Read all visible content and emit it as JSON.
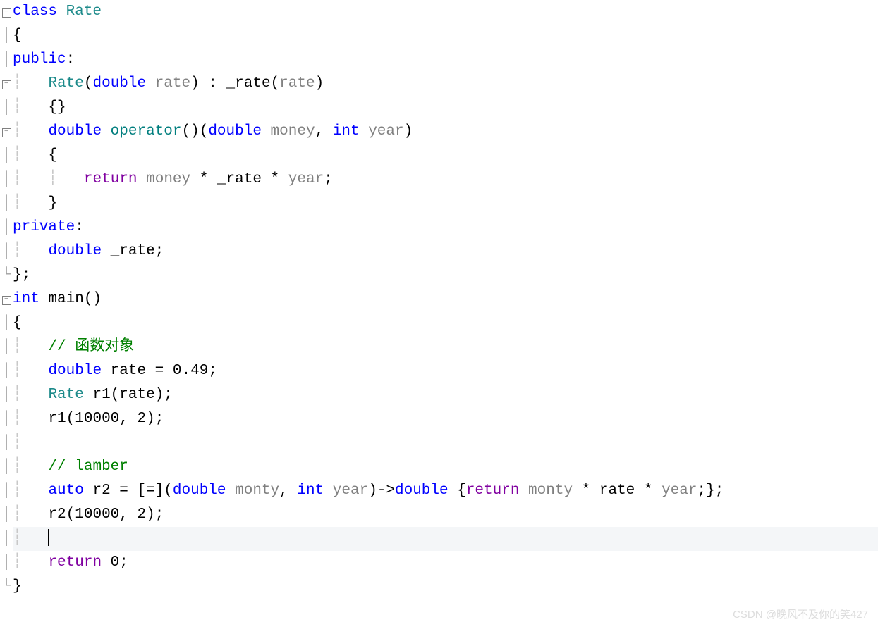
{
  "code": {
    "lines": [
      {
        "gutter": "fold",
        "tokens": [
          {
            "t": "class ",
            "c": "kw-class"
          },
          {
            "t": "Rate",
            "c": "typename"
          }
        ]
      },
      {
        "gutter": "vline",
        "tokens": [
          {
            "t": "{",
            "c": "brace"
          }
        ]
      },
      {
        "gutter": "vline",
        "tokens": [
          {
            "t": "public",
            "c": "kw-access"
          },
          {
            "t": ":",
            "c": "punct"
          }
        ]
      },
      {
        "gutter": "fold",
        "indent": 1,
        "tokens": [
          {
            "t": "Rate",
            "c": "typename"
          },
          {
            "t": "(",
            "c": "punct"
          },
          {
            "t": "double ",
            "c": "kw-type"
          },
          {
            "t": "rate",
            "c": "param"
          },
          {
            "t": ") : _rate(",
            "c": "punct"
          },
          {
            "t": "rate",
            "c": "param"
          },
          {
            "t": ")",
            "c": "punct"
          }
        ]
      },
      {
        "gutter": "vline",
        "indent": 1,
        "tokens": [
          {
            "t": "{}",
            "c": "brace"
          }
        ]
      },
      {
        "gutter": "fold",
        "indent": 1,
        "tokens": [
          {
            "t": "double ",
            "c": "kw-type"
          },
          {
            "t": "operator",
            "c": "kw-op"
          },
          {
            "t": "()(",
            "c": "punct"
          },
          {
            "t": "double ",
            "c": "kw-type"
          },
          {
            "t": "money",
            "c": "param"
          },
          {
            "t": ", ",
            "c": "punct"
          },
          {
            "t": "int ",
            "c": "kw-type"
          },
          {
            "t": "year",
            "c": "param"
          },
          {
            "t": ")",
            "c": "punct"
          }
        ]
      },
      {
        "gutter": "vline",
        "indent": 1,
        "tokens": [
          {
            "t": "{",
            "c": "brace"
          }
        ]
      },
      {
        "gutter": "vline",
        "indent": 2,
        "tokens": [
          {
            "t": "return ",
            "c": "kw-return"
          },
          {
            "t": "money",
            "c": "param"
          },
          {
            "t": " * _rate * ",
            "c": "punct"
          },
          {
            "t": "year",
            "c": "param"
          },
          {
            "t": ";",
            "c": "punct"
          }
        ]
      },
      {
        "gutter": "vline",
        "indent": 1,
        "tokens": [
          {
            "t": "}",
            "c": "brace"
          }
        ]
      },
      {
        "gutter": "vline",
        "tokens": [
          {
            "t": "private",
            "c": "kw-access"
          },
          {
            "t": ":",
            "c": "punct"
          }
        ]
      },
      {
        "gutter": "vline",
        "indent": 1,
        "tokens": [
          {
            "t": "double ",
            "c": "kw-type"
          },
          {
            "t": "_rate;",
            "c": "punct"
          }
        ]
      },
      {
        "gutter": "corner",
        "tokens": [
          {
            "t": "};",
            "c": "brace"
          }
        ]
      },
      {
        "gutter": "fold",
        "tokens": [
          {
            "t": "int ",
            "c": "kw-type"
          },
          {
            "t": "main()",
            "c": "punct"
          }
        ]
      },
      {
        "gutter": "vline",
        "tokens": [
          {
            "t": "{",
            "c": "brace"
          }
        ]
      },
      {
        "gutter": "vline",
        "indent": 1,
        "tokens": [
          {
            "t": "// 函数对象",
            "c": "comment"
          }
        ]
      },
      {
        "gutter": "vline",
        "indent": 1,
        "tokens": [
          {
            "t": "double ",
            "c": "kw-type"
          },
          {
            "t": "rate = ",
            "c": "punct"
          },
          {
            "t": "0.49",
            "c": "num"
          },
          {
            "t": ";",
            "c": "punct"
          }
        ]
      },
      {
        "gutter": "vline",
        "indent": 1,
        "tokens": [
          {
            "t": "Rate ",
            "c": "typename"
          },
          {
            "t": "r1(rate);",
            "c": "punct"
          }
        ]
      },
      {
        "gutter": "vline",
        "indent": 1,
        "tokens": [
          {
            "t": "r1(",
            "c": "punct"
          },
          {
            "t": "10000",
            "c": "num"
          },
          {
            "t": ", ",
            "c": "punct"
          },
          {
            "t": "2",
            "c": "num"
          },
          {
            "t": ");",
            "c": "punct"
          }
        ]
      },
      {
        "gutter": "vline",
        "indent": 1,
        "tokens": []
      },
      {
        "gutter": "vline",
        "indent": 1,
        "tokens": [
          {
            "t": "// lamber",
            "c": "comment"
          }
        ]
      },
      {
        "gutter": "vline",
        "indent": 1,
        "tokens": [
          {
            "t": "auto ",
            "c": "kw-auto"
          },
          {
            "t": "r2 = [=](",
            "c": "punct"
          },
          {
            "t": "double ",
            "c": "kw-type"
          },
          {
            "t": "monty",
            "c": "param"
          },
          {
            "t": ", ",
            "c": "punct"
          },
          {
            "t": "int ",
            "c": "kw-type"
          },
          {
            "t": "year",
            "c": "param"
          },
          {
            "t": ")->",
            "c": "punct"
          },
          {
            "t": "double ",
            "c": "kw-type"
          },
          {
            "t": "{",
            "c": "brace"
          },
          {
            "t": "return ",
            "c": "kw-return"
          },
          {
            "t": "monty",
            "c": "param"
          },
          {
            "t": " * rate * ",
            "c": "punct"
          },
          {
            "t": "year",
            "c": "param"
          },
          {
            "t": ";};",
            "c": "brace"
          }
        ]
      },
      {
        "gutter": "vline",
        "indent": 1,
        "tokens": [
          {
            "t": "r2(",
            "c": "punct"
          },
          {
            "t": "10000",
            "c": "num"
          },
          {
            "t": ", ",
            "c": "punct"
          },
          {
            "t": "2",
            "c": "num"
          },
          {
            "t": ");",
            "c": "punct"
          }
        ]
      },
      {
        "gutter": "vline",
        "indent": 1,
        "highlight": true,
        "cursor": true,
        "tokens": []
      },
      {
        "gutter": "vline",
        "indent": 1,
        "tokens": [
          {
            "t": "return ",
            "c": "kw-return"
          },
          {
            "t": "0",
            "c": "num"
          },
          {
            "t": ";",
            "c": "punct"
          }
        ]
      },
      {
        "gutter": "corner",
        "tokens": [
          {
            "t": "}",
            "c": "brace"
          }
        ]
      }
    ]
  },
  "watermark": "CSDN @晚风不及你的笑427"
}
